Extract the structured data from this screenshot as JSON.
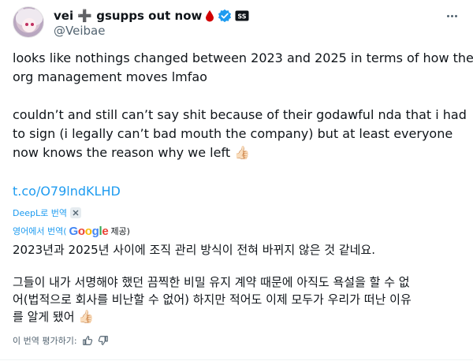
{
  "author": {
    "display_name": "vei ➕ gsupps out now",
    "handle": "@Veibae",
    "badge_tag": "SS"
  },
  "tweet": {
    "lines_p1": [
      "looks like nothings changed between 2023 and 2025 in terms of how the",
      "org management moves lmfao"
    ],
    "lines_p2": [
      "couldn’t and still can’t say shit because of their godawful nda that i had",
      "to sign (i legally  can’t bad mouth the company) but at least everyone",
      "now knows the reason why we left"
    ],
    "emoji": "👍🏻",
    "link": "t.co/O79lndKLHD"
  },
  "translation": {
    "deepl_label": "DeepL로 번역",
    "source_label": "영어에서 번역(",
    "google_letters": [
      "G",
      "o",
      "o",
      "g",
      "l",
      "e"
    ],
    "provided_label": "제공)",
    "line_1": "2023년과 2025년 사이에 조직 관리 방식이 전혀 바뀌지 않은 것 같네요.",
    "lines_p2": [
      "그들이 내가 서명해야 했던 끔찍한 비밀 유지 계약 때문에 아직도 욕설을 할 수 없",
      "어(법적으로 회사를 비난할 수 없어) 하지만 적어도 이제 모두가 우리가 떠난 이유",
      "를 알게 됐어"
    ],
    "emoji": "👍🏻",
    "rate_label": "이 번역 평가하기:"
  },
  "colors": {
    "link": "#1d9bf0",
    "verified": "#1d9bf0",
    "drop": "#d10000",
    "secondary_text": "#536471"
  },
  "icons": [
    "plus-icon",
    "blood-drop-icon",
    "verified-badge-icon",
    "tag-icon",
    "more-icon",
    "thumbs-up-icon",
    "thumbs-down-icon"
  ]
}
